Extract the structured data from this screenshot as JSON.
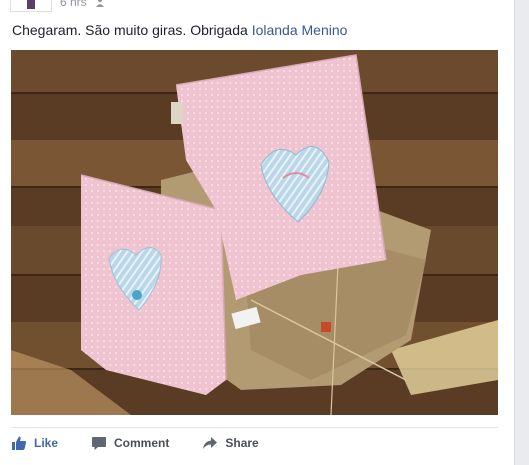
{
  "post": {
    "timestamp": "6 hrs",
    "text": "Chegaram. São muito giras. Obrigada",
    "mention": "Iolanda Menino",
    "photo_alt": "Duas almofadas cor-de-rosa com corações"
  },
  "actions": {
    "like_label": "Like",
    "comment_label": "Comment",
    "share_label": "Share"
  },
  "icons": {
    "like": "thumbs-up-icon",
    "comment": "speech-bubble-icon",
    "share": "share-arrow-icon",
    "audience": "friends-icon"
  },
  "colors": {
    "link": "#365899",
    "like_blue": "#4267b2",
    "action_gray": "#4b4f56",
    "timestamp_gray": "#90949c"
  }
}
